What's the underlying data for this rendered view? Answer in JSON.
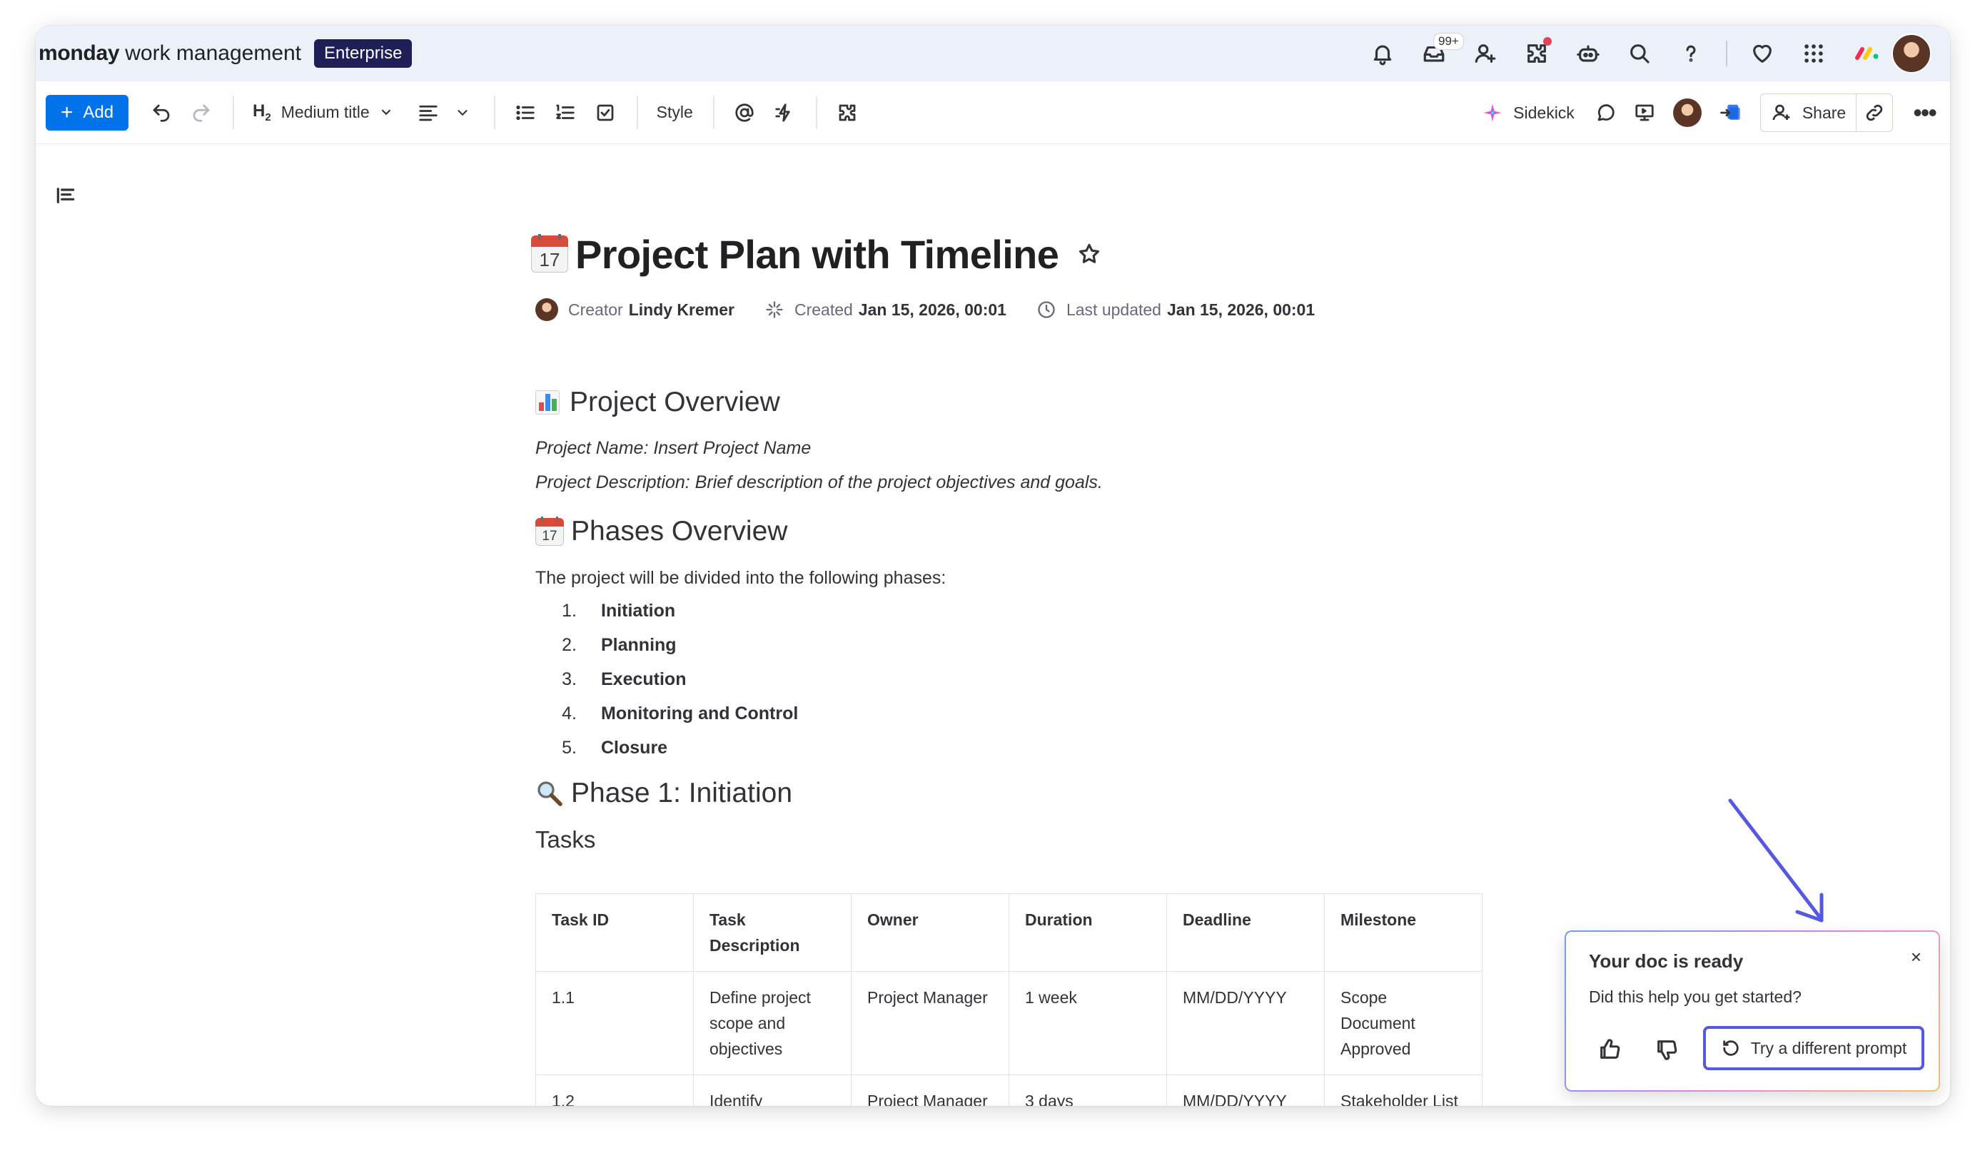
{
  "app": {
    "brand_bold": "monday",
    "brand_light": "work management",
    "plan_badge": "Enterprise",
    "inbox_count": "99+"
  },
  "toolbar": {
    "add_label": "Add",
    "heading_mark": "H",
    "heading_sub": "2",
    "heading_select": "Medium title",
    "style_label": "Style",
    "sidekick_label": "Sidekick",
    "share_label": "Share"
  },
  "doc": {
    "title": "Project Plan with Timeline",
    "cal_day": "17",
    "meta": {
      "creator_label": "Creator",
      "creator_name": "Lindy Kremer",
      "created_label": "Created",
      "created_value": "Jan 15, 2026, 00:01",
      "updated_label": "Last updated",
      "updated_value": "Jan 15, 2026, 00:01"
    },
    "overview": {
      "heading": "Project Overview",
      "line1": "Project Name: Insert Project Name",
      "line2": "Project Description: Brief description of the project objectives and goals."
    },
    "phases": {
      "heading": "Phases Overview",
      "intro": "The project will be divided into the following phases:",
      "items": [
        {
          "num": "1.",
          "label": "Initiation"
        },
        {
          "num": "2.",
          "label": "Planning"
        },
        {
          "num": "3.",
          "label": "Execution"
        },
        {
          "num": "4.",
          "label": "Monitoring and Control"
        },
        {
          "num": "5.",
          "label": "Closure"
        }
      ]
    },
    "phase1": {
      "heading": "Phase 1: Initiation",
      "tasks_heading": "Tasks"
    },
    "table": {
      "headers": [
        "Task ID",
        "Task Description",
        "Owner",
        "Duration",
        "Deadline",
        "Milestone"
      ],
      "rows": [
        [
          "1.1",
          "Define project scope and objectives",
          "Project Manager",
          "1 week",
          "MM/DD/YYYY",
          "Scope Document Approved"
        ],
        [
          "1.2",
          "Identify stakeholders",
          "Project Manager",
          "3 days",
          "MM/DD/YYYY",
          "Stakeholder List Created"
        ]
      ]
    }
  },
  "toast": {
    "title": "Your doc is ready",
    "subtitle": "Did this help you get started?",
    "close": "×",
    "retry_label": "Try a different prompt"
  },
  "colors": {
    "primary": "#0073ea",
    "enterprise_badge": "#1f1f57",
    "topbar_bg": "#ecf0f9",
    "highlight": "#5559df"
  }
}
